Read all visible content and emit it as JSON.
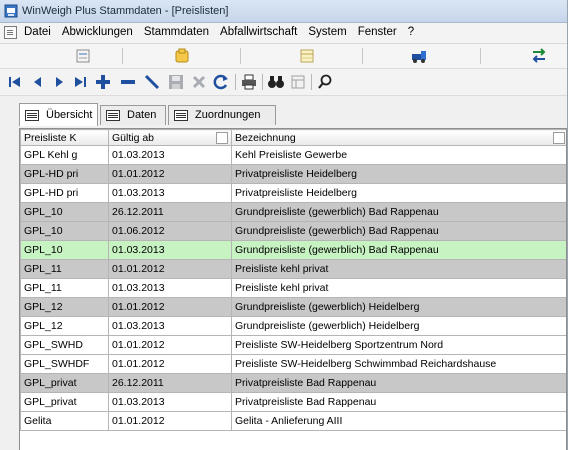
{
  "window": {
    "title": "WinWeigh Plus Stammdaten - [Preislisten]"
  },
  "menu": [
    "Datei",
    "Abwicklungen",
    "Stammdaten",
    "Abfallwirtschaft",
    "System",
    "Fenster",
    "?"
  ],
  "tabs": [
    {
      "label": "Übersicht",
      "active": true
    },
    {
      "label": "Daten",
      "active": false
    },
    {
      "label": "Zuordnungen",
      "active": false
    }
  ],
  "table": {
    "columns": [
      "Preisliste K",
      "Gültig ab",
      "Bezeichnung"
    ],
    "rows": [
      {
        "cells": [
          "GPL Kehl g",
          "01.03.2013",
          "Kehl Preisliste Gewerbe"
        ],
        "state": "white"
      },
      {
        "cells": [
          "GPL-HD pri",
          "01.01.2012",
          "Privatpreisliste Heidelberg"
        ],
        "state": "gray"
      },
      {
        "cells": [
          "GPL-HD pri",
          "01.03.2013",
          "Privatpreisliste Heidelberg"
        ],
        "state": "white"
      },
      {
        "cells": [
          "GPL_10",
          "26.12.2011",
          "Grundpreisliste (gewerblich) Bad Rappenau"
        ],
        "state": "gray"
      },
      {
        "cells": [
          "GPL_10",
          "01.06.2012",
          "Grundpreisliste (gewerblich) Bad Rappenau"
        ],
        "state": "gray"
      },
      {
        "cells": [
          "GPL_10",
          "01.03.2013",
          "Grundpreisliste (gewerblich) Bad Rappenau"
        ],
        "state": "selected"
      },
      {
        "cells": [
          "GPL_11",
          "01.01.2012",
          "Preisliste kehl privat"
        ],
        "state": "gray"
      },
      {
        "cells": [
          "GPL_11",
          "01.03.2013",
          "Preisliste kehl privat"
        ],
        "state": "white"
      },
      {
        "cells": [
          "GPL_12",
          "01.01.2012",
          "Grundpreisliste (gewerblich) Heidelberg"
        ],
        "state": "gray"
      },
      {
        "cells": [
          "GPL_12",
          "01.03.2013",
          "Grundpreisliste (gewerblich) Heidelberg"
        ],
        "state": "white"
      },
      {
        "cells": [
          "GPL_SWHD",
          "01.01.2012",
          "Preisliste SW-Heidelberg Sportzentrum Nord"
        ],
        "state": "white"
      },
      {
        "cells": [
          "GPL_SWHDF",
          "01.01.2012",
          "Preisliste SW-Heidelberg Schwimmbad Reichardshause"
        ],
        "state": "white"
      },
      {
        "cells": [
          "GPL_privat",
          "26.12.2011",
          "Privatpreisliste Bad Rappenau"
        ],
        "state": "gray"
      },
      {
        "cells": [
          "GPL_privat",
          "01.03.2013",
          "Privatpreisliste Bad Rappenau"
        ],
        "state": "white"
      },
      {
        "cells": [
          "Gelita",
          "01.01.2012",
          "Gelita - Anlieferung AIII"
        ],
        "state": "white"
      }
    ]
  },
  "colors": {
    "row_gray": "#c8c8c8",
    "row_selected": "#c7f2c2",
    "nav_blue": "#1f4f9f"
  }
}
